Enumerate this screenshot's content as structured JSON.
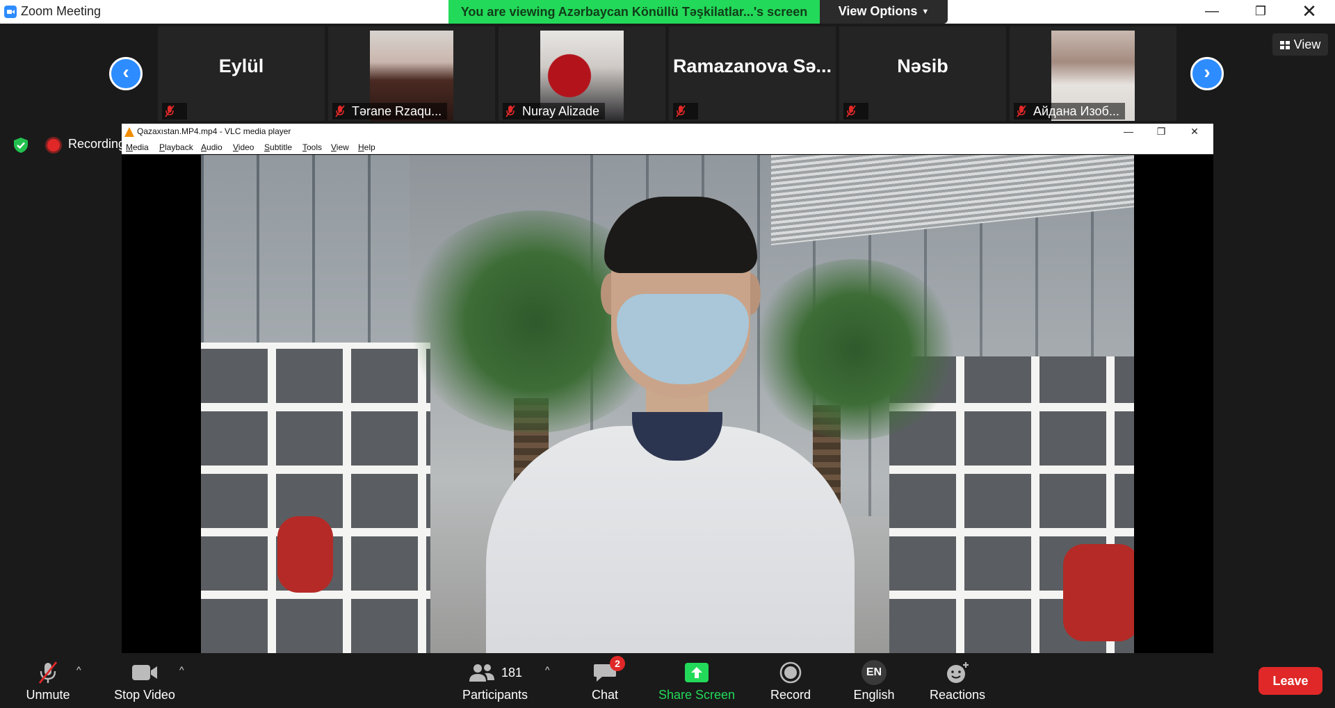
{
  "window": {
    "title": "Zoom Meeting",
    "minimize": "—",
    "maximize": "❐",
    "close": "✕"
  },
  "share_banner": {
    "text": "You are viewing Azərbaycan Könüllü Təşkilatlar...'s screen",
    "view_options": "View Options"
  },
  "strip": {
    "prev": "‹",
    "next": "›",
    "view_label": "View",
    "tiles": [
      {
        "name": "Eylül",
        "label": ""
      },
      {
        "name": "",
        "label": "Tərane Rzaqu..."
      },
      {
        "name": "",
        "label": "Nuray Alizade"
      },
      {
        "name": "Ramazanova  Sə...",
        "label": ""
      },
      {
        "name": "Nəsib",
        "label": ""
      },
      {
        "name": "",
        "label": "Айдана Изоб..."
      }
    ]
  },
  "status": {
    "recording": "Recording"
  },
  "vlc": {
    "title": "Qazaxıstan.MP4.mp4 - VLC media player",
    "menu": [
      {
        "u": "M",
        "rest": "edia"
      },
      {
        "u": "P",
        "rest": "layback"
      },
      {
        "u": "A",
        "rest": "udio"
      },
      {
        "u": "V",
        "rest": "ideo"
      },
      {
        "u": "S",
        "rest": "ubtitle"
      },
      {
        "u": "T",
        "rest": "ools"
      },
      {
        "u": "V",
        "rest": "iew"
      },
      {
        "u": "H",
        "rest": "elp"
      }
    ],
    "min": "—",
    "max": "❐",
    "close": "✕"
  },
  "toolbar": {
    "unmute": "Unmute",
    "stop_video": "Stop Video",
    "participants": "Participants",
    "participants_count": "181",
    "chat": "Chat",
    "chat_badge": "2",
    "share_screen": "Share Screen",
    "record": "Record",
    "language_code": "EN",
    "language": "English",
    "reactions": "Reactions",
    "leave": "Leave",
    "caret": "^"
  },
  "colors": {
    "zoom_blue": "#2d8cff",
    "share_green": "#23d959",
    "leave_red": "#e02828",
    "background": "#1a1a1a"
  }
}
